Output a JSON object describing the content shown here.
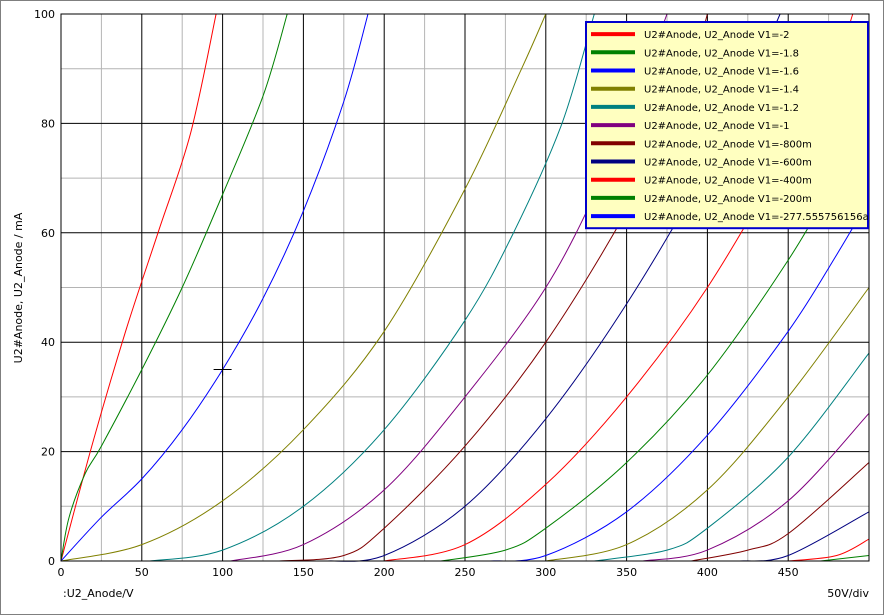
{
  "chart_data": {
    "type": "line",
    "title": "",
    "xlabel": ":U2_Anode/V",
    "ylabel": "U2#Anode, U2_Anode / mA",
    "x_scale_note": "50V/div",
    "xlim": [
      0,
      500
    ],
    "ylim": [
      0,
      100
    ],
    "x_ticks": [
      0,
      50,
      100,
      150,
      200,
      250,
      300,
      350,
      400,
      450
    ],
    "y_ticks": [
      0,
      20,
      40,
      60,
      80,
      100
    ],
    "grid": true,
    "legend_position": "top-right",
    "cursor": {
      "x": 100,
      "y": 35
    },
    "series": [
      {
        "name": "U2#Anode, U2_Anode V1=-2",
        "color": "#ff0000",
        "points": [
          [
            0,
            0
          ],
          [
            20,
            22
          ],
          [
            40,
            42
          ],
          [
            60,
            60
          ],
          [
            80,
            78
          ],
          [
            96,
            100
          ]
        ]
      },
      {
        "name": "U2#Anode, U2_Anode V1=-1.8",
        "color": "#008000",
        "points": [
          [
            0,
            0
          ],
          [
            5,
            8
          ],
          [
            15,
            16
          ],
          [
            25,
            21
          ],
          [
            50,
            35
          ],
          [
            75,
            50
          ],
          [
            100,
            67
          ],
          [
            125,
            85
          ],
          [
            140,
            100
          ]
        ]
      },
      {
        "name": "U2#Anode, U2_Anode V1=-1.6",
        "color": "#0000ff",
        "points": [
          [
            0,
            0
          ],
          [
            25,
            8
          ],
          [
            50,
            15
          ],
          [
            75,
            24
          ],
          [
            100,
            35
          ],
          [
            125,
            48
          ],
          [
            150,
            64
          ],
          [
            175,
            84
          ],
          [
            190,
            100
          ]
        ]
      },
      {
        "name": "U2#Anode, U2_Anode V1=-1.4",
        "color": "#808000",
        "points": [
          [
            0,
            0
          ],
          [
            50,
            3
          ],
          [
            100,
            11
          ],
          [
            150,
            24
          ],
          [
            200,
            42
          ],
          [
            250,
            68
          ],
          [
            285,
            90
          ],
          [
            300,
            100
          ]
        ]
      },
      {
        "name": "U2#Anode, U2_Anode V1=-1.2",
        "color": "#008080",
        "points": [
          [
            55,
            0
          ],
          [
            100,
            2
          ],
          [
            150,
            10
          ],
          [
            200,
            24
          ],
          [
            250,
            44
          ],
          [
            280,
            60
          ],
          [
            310,
            80
          ],
          [
            330,
            100
          ]
        ]
      },
      {
        "name": "U2#Anode, U2_Anode V1=-1",
        "color": "#800080",
        "points": [
          [
            105,
            0
          ],
          [
            150,
            3
          ],
          [
            200,
            13
          ],
          [
            250,
            30
          ],
          [
            300,
            50
          ],
          [
            335,
            70
          ],
          [
            360,
            88
          ],
          [
            375,
            100
          ]
        ]
      },
      {
        "name": "U2#Anode, U2_Anode V1=-800m",
        "color": "#800000",
        "points": [
          [
            135,
            0
          ],
          [
            175,
            1
          ],
          [
            200,
            6
          ],
          [
            250,
            21
          ],
          [
            300,
            40
          ],
          [
            350,
            64
          ],
          [
            385,
            85
          ],
          [
            400,
            100
          ]
        ]
      },
      {
        "name": "U2#Anode, U2_Anode V1=-600m",
        "color": "#000080",
        "points": [
          [
            165,
            0
          ],
          [
            200,
            1
          ],
          [
            250,
            10
          ],
          [
            300,
            26
          ],
          [
            350,
            47
          ],
          [
            400,
            72
          ],
          [
            430,
            90
          ],
          [
            445,
            100
          ]
        ]
      },
      {
        "name": "U2#Anode, U2_Anode V1=-400m",
        "color": "#ff0000",
        "points": [
          [
            200,
            0
          ],
          [
            250,
            3
          ],
          [
            300,
            14
          ],
          [
            350,
            30
          ],
          [
            400,
            50
          ],
          [
            450,
            75
          ],
          [
            480,
            92
          ],
          [
            490,
            100
          ]
        ]
      },
      {
        "name": "U2#Anode, U2_Anode V1=-200m",
        "color": "#008000",
        "points": [
          [
            235,
            0
          ],
          [
            275,
            2
          ],
          [
            300,
            6
          ],
          [
            350,
            18
          ],
          [
            400,
            34
          ],
          [
            450,
            55
          ],
          [
            480,
            70
          ],
          [
            500,
            80
          ]
        ]
      },
      {
        "name": "U2#Anode, U2_Anode V1=-277.555756156a",
        "color": "#0000ff",
        "points": [
          [
            265,
            0
          ],
          [
            300,
            1
          ],
          [
            350,
            9
          ],
          [
            400,
            23
          ],
          [
            450,
            42
          ],
          [
            480,
            56
          ],
          [
            500,
            66
          ]
        ]
      },
      {
        "name": "",
        "color": "#808000",
        "points": [
          [
            300,
            0
          ],
          [
            350,
            3
          ],
          [
            400,
            13
          ],
          [
            450,
            30
          ],
          [
            500,
            50
          ]
        ]
      },
      {
        "name": "",
        "color": "#008080",
        "points": [
          [
            330,
            0
          ],
          [
            375,
            2
          ],
          [
            400,
            6
          ],
          [
            450,
            19
          ],
          [
            500,
            38
          ]
        ]
      },
      {
        "name": "",
        "color": "#800080",
        "points": [
          [
            360,
            0
          ],
          [
            400,
            2
          ],
          [
            450,
            11
          ],
          [
            500,
            27
          ]
        ]
      },
      {
        "name": "",
        "color": "#800000",
        "points": [
          [
            390,
            0
          ],
          [
            425,
            2
          ],
          [
            450,
            5
          ],
          [
            500,
            18
          ]
        ]
      },
      {
        "name": "",
        "color": "#000080",
        "points": [
          [
            420,
            0
          ],
          [
            450,
            1
          ],
          [
            500,
            9
          ]
        ]
      },
      {
        "name": "",
        "color": "#ff0000",
        "points": [
          [
            450,
            0
          ],
          [
            480,
            1
          ],
          [
            500,
            4
          ]
        ]
      },
      {
        "name": "",
        "color": "#008000",
        "points": [
          [
            470,
            0
          ],
          [
            500,
            1
          ]
        ]
      }
    ]
  }
}
